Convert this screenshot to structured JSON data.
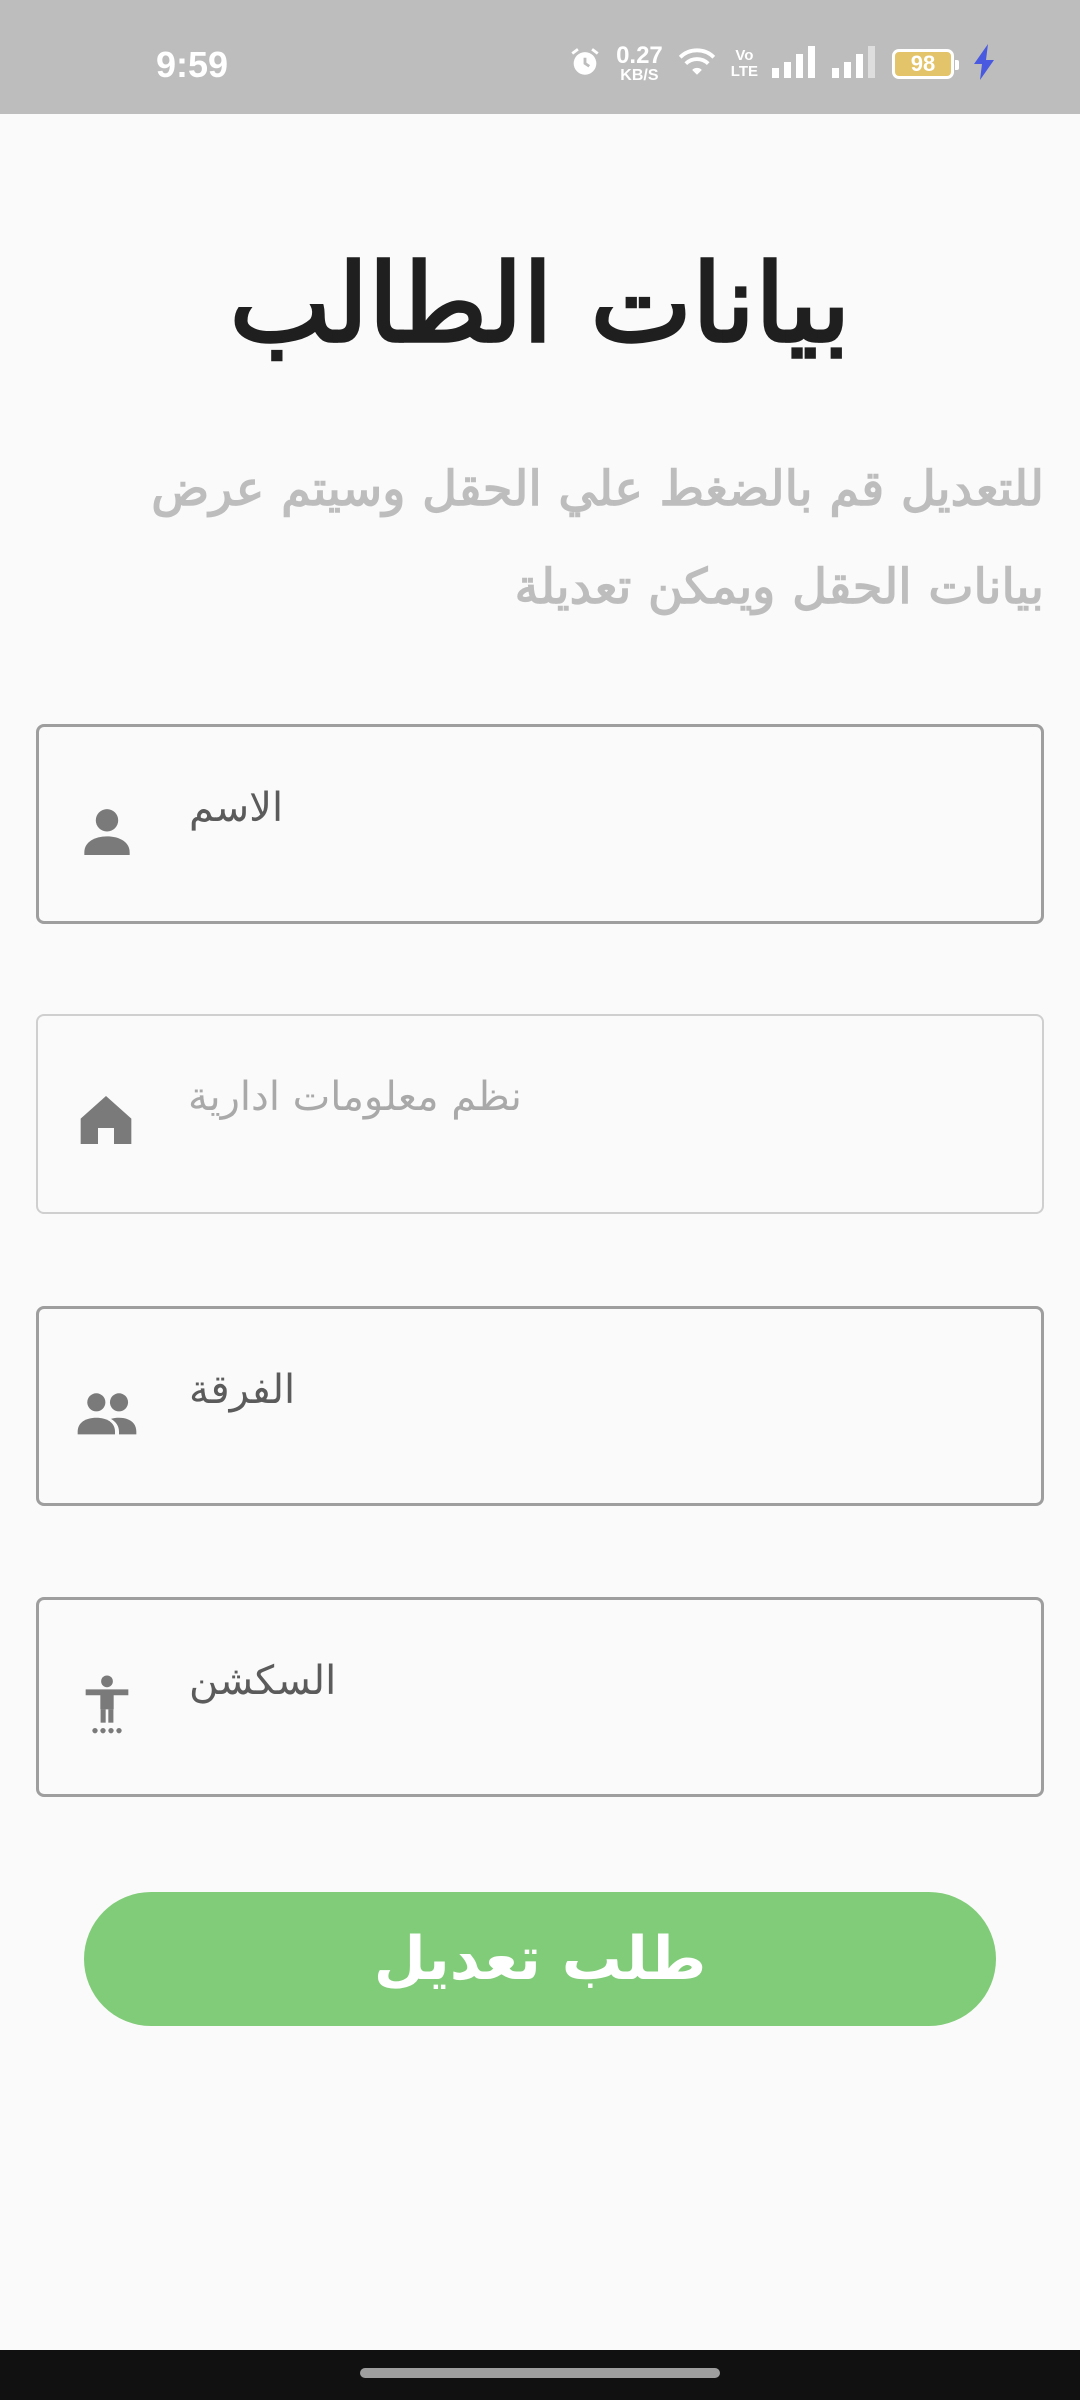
{
  "status_bar": {
    "time": "9:59",
    "speed_value": "0.27",
    "speed_unit": "KB/S",
    "volte_top": "Vo",
    "volte_bottom": "LTE",
    "battery": "98"
  },
  "title": "بيانات الطالب",
  "subtitle": "للتعديل قم بالضغط علي الحقل وسيتم عرض بيانات الحقل ويمكن تعديلة",
  "fields": [
    {
      "icon": "person-icon",
      "value": "الاسم",
      "enabled": true
    },
    {
      "icon": "home-icon",
      "value": "نظم معلومات ادارية",
      "enabled": false
    },
    {
      "icon": "group-icon",
      "value": "الفرقة",
      "enabled": true
    },
    {
      "icon": "accessibility-icon",
      "value": "السكشن",
      "enabled": true
    }
  ],
  "submit_button": "طلب تعديل",
  "colors": {
    "accent_green": "#81cc78",
    "status_bar_bg": "#bdbdbd",
    "field_border": "#9e9e9e",
    "subtitle_gray": "#bdbdbd"
  }
}
